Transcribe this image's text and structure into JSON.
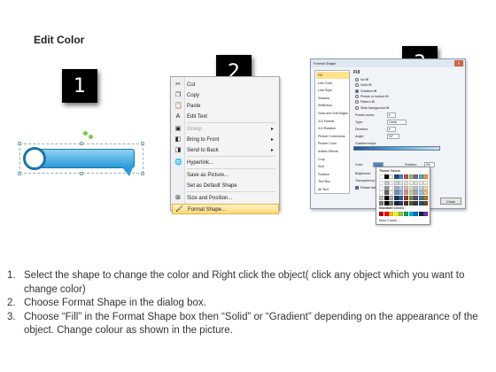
{
  "page": {
    "title": "Edit Color"
  },
  "markers": [
    "1",
    "2",
    "3"
  ],
  "context_menu": {
    "items": [
      {
        "icon": "scissors-icon",
        "glyph": "✂",
        "label": "Cut",
        "disabled": false,
        "submenu": false
      },
      {
        "icon": "copy-icon",
        "glyph": "❐",
        "label": "Copy",
        "disabled": false,
        "submenu": false
      },
      {
        "icon": "paste-icon",
        "glyph": "📋",
        "label": "Paste",
        "disabled": false,
        "submenu": false
      },
      {
        "icon": "edit-text-icon",
        "glyph": "A",
        "label": "Edit Text",
        "disabled": false,
        "submenu": false
      },
      {
        "icon": "group-icon",
        "glyph": "▣",
        "label": "Group",
        "disabled": true,
        "submenu": true
      },
      {
        "icon": "bring-to-front-icon",
        "glyph": "◧",
        "label": "Bring to Front",
        "disabled": false,
        "submenu": true
      },
      {
        "icon": "send-to-back-icon",
        "glyph": "◨",
        "label": "Send to Back",
        "disabled": false,
        "submenu": true
      },
      {
        "icon": "hyperlink-icon",
        "glyph": "🌐",
        "label": "Hyperlink...",
        "disabled": false,
        "submenu": false
      },
      {
        "icon": "",
        "glyph": "",
        "label": "Save as Picture...",
        "disabled": false,
        "submenu": false
      },
      {
        "icon": "",
        "glyph": "",
        "label": "Set as Default Shape",
        "disabled": false,
        "submenu": false
      },
      {
        "icon": "size-position-icon",
        "glyph": "⊞",
        "label": "Size and Position...",
        "disabled": false,
        "submenu": false
      },
      {
        "icon": "format-shape-icon",
        "glyph": "🖌",
        "label": "Format Shape...",
        "disabled": false,
        "submenu": false,
        "highlighted": true
      }
    ]
  },
  "dialog": {
    "title": "Format Shape",
    "categories": [
      "Fill",
      "Line Color",
      "Line Style",
      "Shadow",
      "Reflection",
      "Glow and Soft Edges",
      "3-D Format",
      "3-D Rotation",
      "Picture Corrections",
      "Picture Color",
      "Artistic Effects",
      "Crop",
      "Size",
      "Position",
      "Text Box",
      "Alt Text"
    ],
    "selected_category": "Fill",
    "pane_heading": "Fill",
    "fill_options": [
      "No fill",
      "Solid fill",
      "Gradient fill",
      "Picture or texture fill",
      "Pattern fill",
      "Slide background fill"
    ],
    "selected_fill": "Gradient fill",
    "labels": {
      "preset": "Preset colors:",
      "type": "Type:",
      "type_value": "Linear",
      "direction": "Direction:",
      "angle": "Angle:",
      "angle_value": "90°",
      "gradient_stops": "Gradient stops",
      "color": "Color",
      "position": "Position:",
      "position_value": "0%",
      "brightness": "Brightness:",
      "transparency": "Transparency:",
      "rotate": "Rotate with shape",
      "close": "Close"
    }
  },
  "color_popup": {
    "theme_heading": "Theme Colors",
    "standard_heading": "Standard Colors",
    "more": "More Colors...",
    "theme_top": [
      "#ffffff",
      "#000000",
      "#eeece1",
      "#1f497d",
      "#4f81bd",
      "#c0504d",
      "#9bbb59",
      "#8064a2",
      "#4bacc6",
      "#f79646"
    ],
    "standard": [
      "#c00000",
      "#ff0000",
      "#ffc000",
      "#ffff00",
      "#92d050",
      "#00b050",
      "#00b0f0",
      "#0070c0",
      "#002060",
      "#7030a0"
    ]
  },
  "instructions": [
    {
      "num": "1.",
      "text": "Select the shape to change the color and Right click the object( click any object which you want to change color)"
    },
    {
      "num": "2.",
      "text": "Choose Format Shape in the dialog box."
    },
    {
      "num": "3.",
      "text": "Choose “Fill” in the Format Shape box then “Solid” or “Gradient” depending on the appearance of the object. Change colour as shown in the picture."
    }
  ]
}
